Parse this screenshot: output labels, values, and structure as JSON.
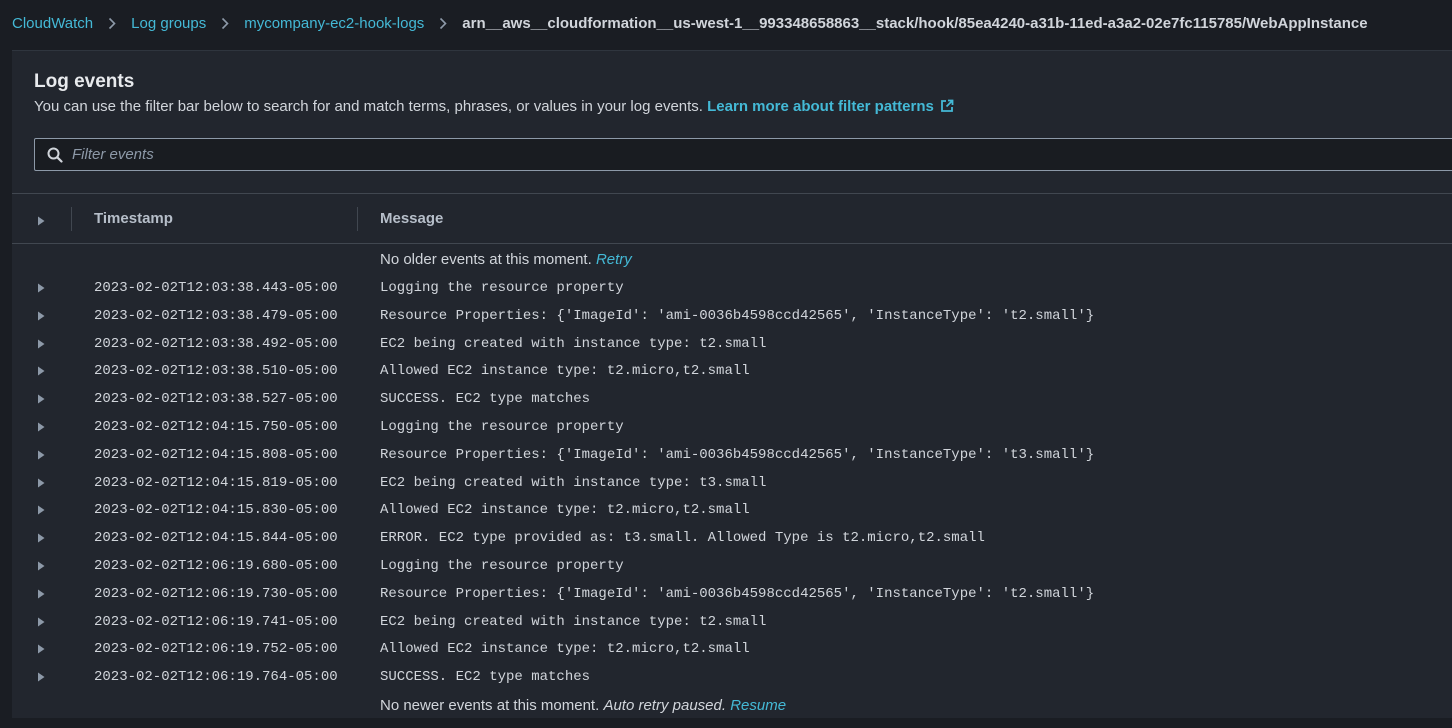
{
  "breadcrumb": {
    "items": [
      {
        "label": "CloudWatch"
      },
      {
        "label": "Log groups"
      },
      {
        "label": "mycompany-ec2-hook-logs"
      }
    ],
    "current": "arn__aws__cloudformation__us-west-1__993348658863__stack/hook/85ea4240-a31b-11ed-a3a2-02e7fc115785/WebAppInstance"
  },
  "panel": {
    "title": "Log events",
    "description": "You can use the filter bar below to search for and match terms, phrases, or values in your log events.",
    "learn_more": "Learn more about filter patterns"
  },
  "filter": {
    "placeholder": "Filter events",
    "value": ""
  },
  "table": {
    "headers": {
      "timestamp": "Timestamp",
      "message": "Message"
    },
    "older": {
      "text": "No older events at this moment.",
      "retry": "Retry"
    },
    "rows": [
      {
        "timestamp": "2023-02-02T12:03:38.443-05:00",
        "message": "Logging the resource property"
      },
      {
        "timestamp": "2023-02-02T12:03:38.479-05:00",
        "message": "Resource Properties: {'ImageId': 'ami-0036b4598ccd42565', 'InstanceType': 't2.small'}"
      },
      {
        "timestamp": "2023-02-02T12:03:38.492-05:00",
        "message": "EC2 being created with instance type: t2.small"
      },
      {
        "timestamp": "2023-02-02T12:03:38.510-05:00",
        "message": "Allowed EC2 instance type: t2.micro,t2.small"
      },
      {
        "timestamp": "2023-02-02T12:03:38.527-05:00",
        "message": "SUCCESS. EC2 type matches"
      },
      {
        "timestamp": "2023-02-02T12:04:15.750-05:00",
        "message": "Logging the resource property"
      },
      {
        "timestamp": "2023-02-02T12:04:15.808-05:00",
        "message": "Resource Properties: {'ImageId': 'ami-0036b4598ccd42565', 'InstanceType': 't3.small'}"
      },
      {
        "timestamp": "2023-02-02T12:04:15.819-05:00",
        "message": "EC2 being created with instance type: t3.small"
      },
      {
        "timestamp": "2023-02-02T12:04:15.830-05:00",
        "message": "Allowed EC2 instance type: t2.micro,t2.small"
      },
      {
        "timestamp": "2023-02-02T12:04:15.844-05:00",
        "message": "ERROR. EC2 type provided as: t3.small. Allowed Type is t2.micro,t2.small"
      },
      {
        "timestamp": "2023-02-02T12:06:19.680-05:00",
        "message": "Logging the resource property"
      },
      {
        "timestamp": "2023-02-02T12:06:19.730-05:00",
        "message": "Resource Properties: {'ImageId': 'ami-0036b4598ccd42565', 'InstanceType': 't2.small'}"
      },
      {
        "timestamp": "2023-02-02T12:06:19.741-05:00",
        "message": "EC2 being created with instance type: t2.small"
      },
      {
        "timestamp": "2023-02-02T12:06:19.752-05:00",
        "message": "Allowed EC2 instance type: t2.micro,t2.small"
      },
      {
        "timestamp": "2023-02-02T12:06:19.764-05:00",
        "message": "SUCCESS. EC2 type matches"
      }
    ],
    "newer": {
      "text": "No newer events at this moment.",
      "paused": "Auto retry paused.",
      "resume": "Resume"
    }
  },
  "colors": {
    "background": "#1a1d23",
    "panel": "#22262e",
    "link": "#44b9d6",
    "text": "#d1d5db"
  },
  "icons": {
    "breadcrumb_separator": "chevron-right-icon",
    "external_link": "external-link-icon",
    "search": "search-icon",
    "row_expand": "caret-right-icon"
  }
}
